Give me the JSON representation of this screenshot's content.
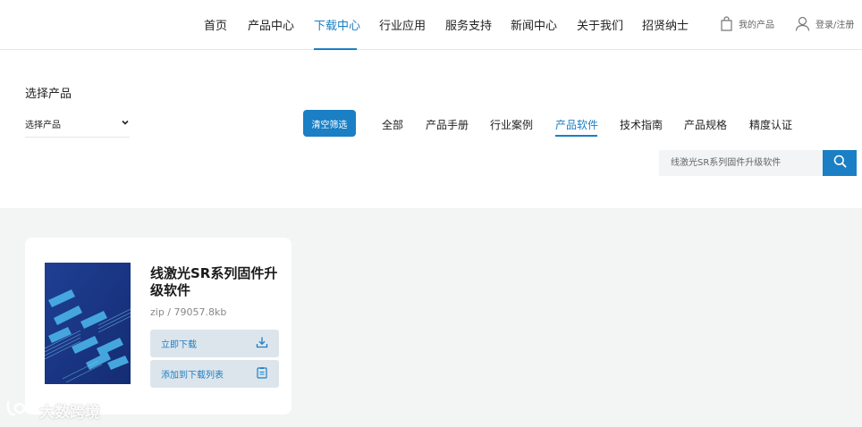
{
  "nav": {
    "items": [
      "首页",
      "产品中心",
      "下载中心",
      "行业应用",
      "服务支持",
      "新闻中心",
      "关于我们",
      "招贤纳士"
    ],
    "active": "下载中心",
    "my_products": "我的产品",
    "login": "登录/注册"
  },
  "filter": {
    "title": "选择产品",
    "select_value": "选择产品",
    "clear_button": "清空筛选",
    "tabs": [
      "全部",
      "产品手册",
      "行业案例",
      "产品软件",
      "技术指南",
      "产品规格",
      "精度认证"
    ],
    "active_tab": "产品软件",
    "search_placeholder": "线激光SR系列固件升级软件"
  },
  "card": {
    "title": "线激光SR系列固件升级软件",
    "meta": "zip / 79057.8kb",
    "download_label": "立即下载",
    "add_list_label": "添加到下载列表"
  },
  "watermark": "大数跨境",
  "colors": {
    "accent": "#1a7fc4",
    "content_bg": "#f3f5f5",
    "action_bg": "#dde5ec"
  }
}
